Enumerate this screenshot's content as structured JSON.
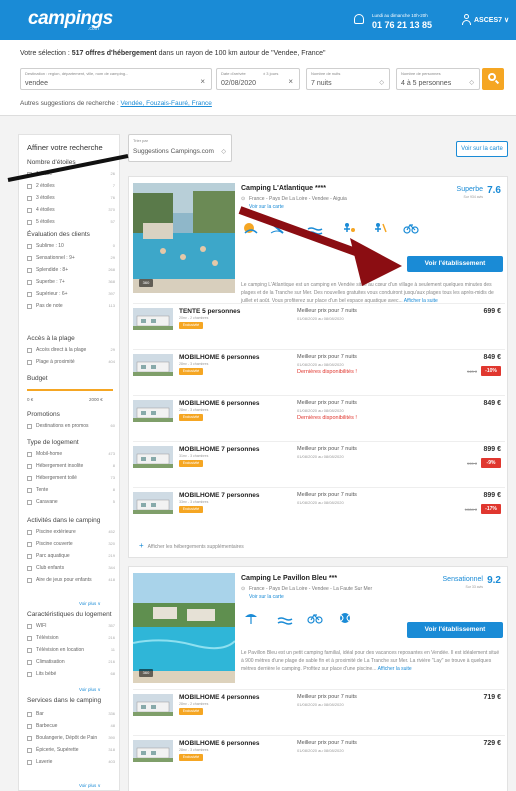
{
  "header": {
    "logo": "campings",
    "logo_sub": ".com",
    "phone_hours": "Lundi au dimanche 10h-20h",
    "phone": "01 76 21 13 85",
    "account": "ASCES7 ∨"
  },
  "search": {
    "selection_prefix": "Votre sélection : ",
    "selection_count": "517 offres d'hébergement",
    "selection_suffix": " dans un rayon de 100 km autour de \"Vendee, France\"",
    "destination": {
      "label": "Destination : region, département, ville, nom de camping...",
      "value": "vendee",
      "clear": "×"
    },
    "arrival": {
      "label": "Date d'arrivée",
      "flex": "± 3 jours",
      "value": "02/08/2020",
      "clear": "×"
    },
    "nights": {
      "label": "Nombre de nuits",
      "value": "7 nuits"
    },
    "persons": {
      "label": "Nombre de personnes",
      "value": "4 à 5 personnes"
    },
    "other_suggest_label": "Autres suggestions de recherche :",
    "other_suggest_link": "Vendée, Fouzais-Fauré, France"
  },
  "sidebar": {
    "title": "Affiner votre recherche",
    "stars": {
      "title": "Nombre d'étoiles",
      "items": [
        {
          "label": "1 étoile",
          "count": "26"
        },
        {
          "label": "2 étoiles",
          "count": "7"
        },
        {
          "label": "3 étoiles",
          "count": "76"
        },
        {
          "label": "4 étoiles",
          "count": "370"
        },
        {
          "label": "5 étoiles",
          "count": "57"
        }
      ]
    },
    "reviews": {
      "title": "Évaluation des clients",
      "items": [
        {
          "label": "Sublime : 10",
          "count": "0"
        },
        {
          "label": "Sensationnel : 9+",
          "count": "29"
        },
        {
          "label": "Splendide : 8+",
          "count": "268"
        },
        {
          "label": "Superbe : 7+",
          "count": "368"
        },
        {
          "label": "Supérieur : 6+",
          "count": "397"
        },
        {
          "label": "Pas de note",
          "count": "113"
        }
      ]
    },
    "beach": {
      "title": "Accès à la plage",
      "items": [
        {
          "label": "Accès direct à la plage",
          "count": "29"
        },
        {
          "label": "Plage à proximité",
          "count": "404"
        }
      ]
    },
    "budget": {
      "title": "Budget",
      "min": "0 €",
      "max": "2000 €"
    },
    "promos": {
      "title": "Promotions",
      "items": [
        {
          "label": "Destinations en promos",
          "count": "60"
        }
      ]
    },
    "lodging": {
      "title": "Type de logement",
      "items": [
        {
          "label": "Mobil-home",
          "count": "473"
        },
        {
          "label": "Hébergement insolite",
          "count": "8"
        },
        {
          "label": "Hébergement toilé",
          "count": "73"
        },
        {
          "label": "Tente",
          "count": "8"
        },
        {
          "label": "Caravane",
          "count": "5"
        }
      ]
    },
    "activities": {
      "title": "Activités dans le camping",
      "items": [
        {
          "label": "Piscine extérieure",
          "count": "452"
        },
        {
          "label": "Piscine couverte",
          "count": "320"
        },
        {
          "label": "Parc aquatique",
          "count": "219"
        },
        {
          "label": "Club enfants",
          "count": "344"
        },
        {
          "label": "Aire de jeux pour enfants",
          "count": "418"
        }
      ],
      "more": "Voir plus  ∨"
    },
    "features": {
      "title": "Caractéristiques du logement",
      "items": [
        {
          "label": "WIFI",
          "count": "357"
        },
        {
          "label": "Télévision",
          "count": "216"
        },
        {
          "label": "Télévision en location",
          "count": "11"
        },
        {
          "label": "Climatisation",
          "count": "216"
        },
        {
          "label": "Lits bébé",
          "count": "68"
        }
      ],
      "more": "Voir plus  ∨"
    },
    "services": {
      "title": "Services dans le camping",
      "items": [
        {
          "label": "Bar",
          "count": "336"
        },
        {
          "label": "Barbecue",
          "count": "48"
        },
        {
          "label": "Boulangerie, Dépôt de Pain",
          "count": "390"
        },
        {
          "label": "Épicerie, Supérette",
          "count": "318"
        },
        {
          "label": "Laverie",
          "count": "403"
        }
      ],
      "more": "Voir plus  ∨"
    }
  },
  "sort": {
    "label": "Trier par",
    "value": "Suggestions Campings.com"
  },
  "map_button": "Voir sur la carte",
  "cards": [
    {
      "name": "Camping L'Atlantique",
      "stars": "****",
      "location": "France - Pays De La Loire - Vendee - Aiguia",
      "map_link": "Voir sur la carte",
      "rating_word": "Superbe",
      "rating_reviews": "Sur 934 avis",
      "rating_score": "7.6",
      "cta": "Voir l'établissement",
      "badge": "360",
      "description": "Le camping L'Atlantique est un camping en Vendée situé au cœur d'un village à seulement quelques minutes des plages et de la Tranche sur Mer. Des nouvelles gratuites vous conduiront jusqu'aux plages tous les après-midis de juillet et août. Vous profiterez sur place d'un bel espace aquatique avec...",
      "description_more": "Afficher la suite",
      "offers": [
        {
          "name": "TENTE 5 personnes",
          "sub": "20m² - 2 chambres",
          "exc": "Exclusivité",
          "best": "Meilleur prix pour 7 nuits",
          "dates": "01/08/2020 au 08/08/2020",
          "last": "",
          "price": "699 €",
          "old": "",
          "disc": ""
        },
        {
          "name": "MOBILHOME 6 personnes",
          "sub": "28m² - 3 chambres",
          "exc": "Exclusivité",
          "best": "Meilleur prix pour 7 nuits",
          "dates": "01/08/2020 au 08/08/2020",
          "last": "Dernières disponibilités !",
          "price": "849 €",
          "old": "943 €",
          "disc": "-10%"
        },
        {
          "name": "MOBILHOME 6 personnes",
          "sub": "28m² - 3 chambres",
          "exc": "Exclusivité",
          "best": "Meilleur prix pour 7 nuits",
          "dates": "01/08/2020 au 08/08/2020",
          "last": "Dernières disponibilités !",
          "price": "849 €",
          "old": "",
          "disc": ""
        },
        {
          "name": "MOBILHOME 7 personnes",
          "sub": "31m² - 3 chambres",
          "exc": "Exclusivité",
          "best": "Meilleur prix pour 7 nuits",
          "dates": "01/08/2020 au 08/08/2020",
          "last": "",
          "price": "899 €",
          "old": "999 €",
          "disc": "-9%"
        },
        {
          "name": "MOBILHOME 7 personnes",
          "sub": "33m² - 3 chambres",
          "exc": "Exclusivité",
          "best": "Meilleur prix pour 7 nuits",
          "dates": "01/08/2020 au 08/08/2020",
          "last": "",
          "price": "899 €",
          "old": "1084 €",
          "disc": "-17%"
        }
      ],
      "more_offers": "Afficher les hébergements supplémentaires"
    },
    {
      "name": "Camping Le Pavillon Bleu",
      "stars": "***",
      "location": "France - Pays De La Loire - Vendee - La Faute Sur Mer",
      "map_link": "Voir sur la carte",
      "rating_word": "Sensationnel",
      "rating_reviews": "Sur 33 avis",
      "rating_score": "9.2",
      "cta": "Voir l'établissement",
      "badge": "360",
      "description": "Le Pavillon Bleu est un petit camping familial, idéal pour des vacances reposantes en Vendée. Il est idéalement situé à 900 mètres d'une plage de sable fin et à proximité de La Tranche sur Mer. La rivière \"Lay\" se trouve à quelques mètres derrière le camping. Profitez sur place d'une piscine...",
      "description_more": "Afficher la suite",
      "offers": [
        {
          "name": "MOBILHOME 4 personnes",
          "sub": "28m² - 2 chambres",
          "exc": "Exclusivité",
          "best": "Meilleur prix pour 7 nuits",
          "dates": "01/08/2020 au 08/08/2020",
          "last": "",
          "price": "719 €",
          "old": "",
          "disc": ""
        },
        {
          "name": "MOBILHOME 6 personnes",
          "sub": "28m² - 3 chambres",
          "exc": "Exclusivité",
          "best": "Meilleur prix pour 7 nuits",
          "dates": "01/08/2020 au 08/08/2020",
          "last": "",
          "price": "729 €",
          "old": "",
          "disc": ""
        }
      ]
    }
  ],
  "colors": {
    "brand": "#1a8bd6",
    "accent": "#f5a623",
    "alert": "#e0372f",
    "annotation": "#8b0d12"
  }
}
